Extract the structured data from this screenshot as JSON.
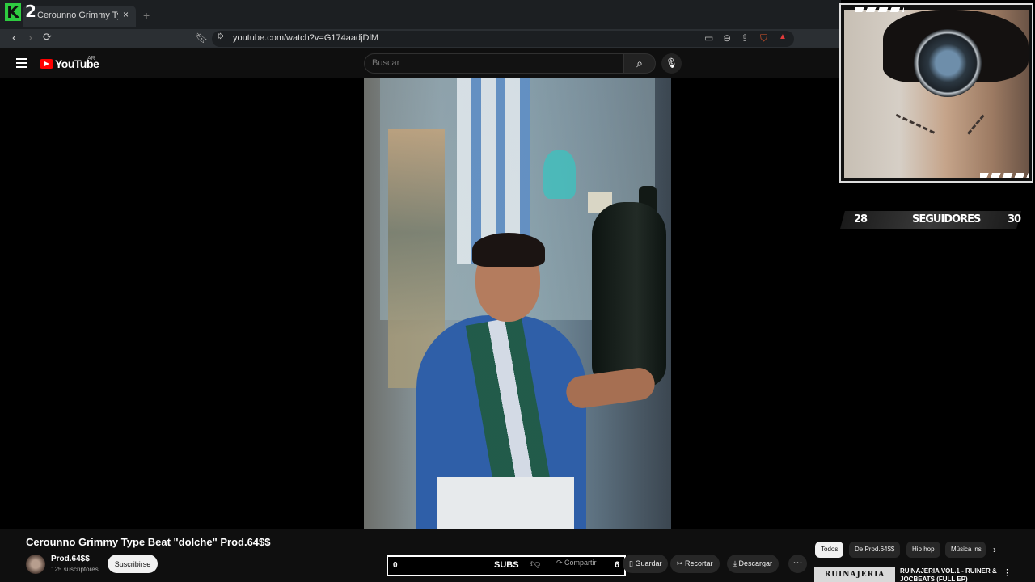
{
  "overlay": {
    "brand_letter": "K",
    "brand_number": "2"
  },
  "browser": {
    "tab_title": "Cerounno Grimmy Type Beat",
    "tab_close": "×",
    "new_tab": "+",
    "url": "youtube.com/watch?v=G174aadjDlM"
  },
  "youtube": {
    "wordmark": "YouTube",
    "country": "AR",
    "search_placeholder": "Buscar"
  },
  "webcam": {
    "followers_left": "28",
    "followers_label": "SEGUIDORES",
    "followers_right": "30"
  },
  "video": {
    "title": "Cerounno Grimmy Type Beat \"dolche\" Prod.64$$",
    "channel": "Prod.64$$",
    "subscribers": "125 suscriptores",
    "subscribe_label": "Suscribirse"
  },
  "subs_goal": {
    "left": "0",
    "label": "SUBS",
    "right": "6"
  },
  "actions": {
    "share": "Compartir",
    "save": "Guardar",
    "clip": "Recortar",
    "download": "Descargar",
    "more": "⋯"
  },
  "chips": [
    "Todos",
    "De Prod.64$$",
    "Hip hop",
    "Música ins"
  ],
  "recommendation": {
    "thumb_text": "RUINAJERIA",
    "title": "RUINAJERIA VOL.1 - RUINER & JOCBEATS (FULL EP)"
  }
}
